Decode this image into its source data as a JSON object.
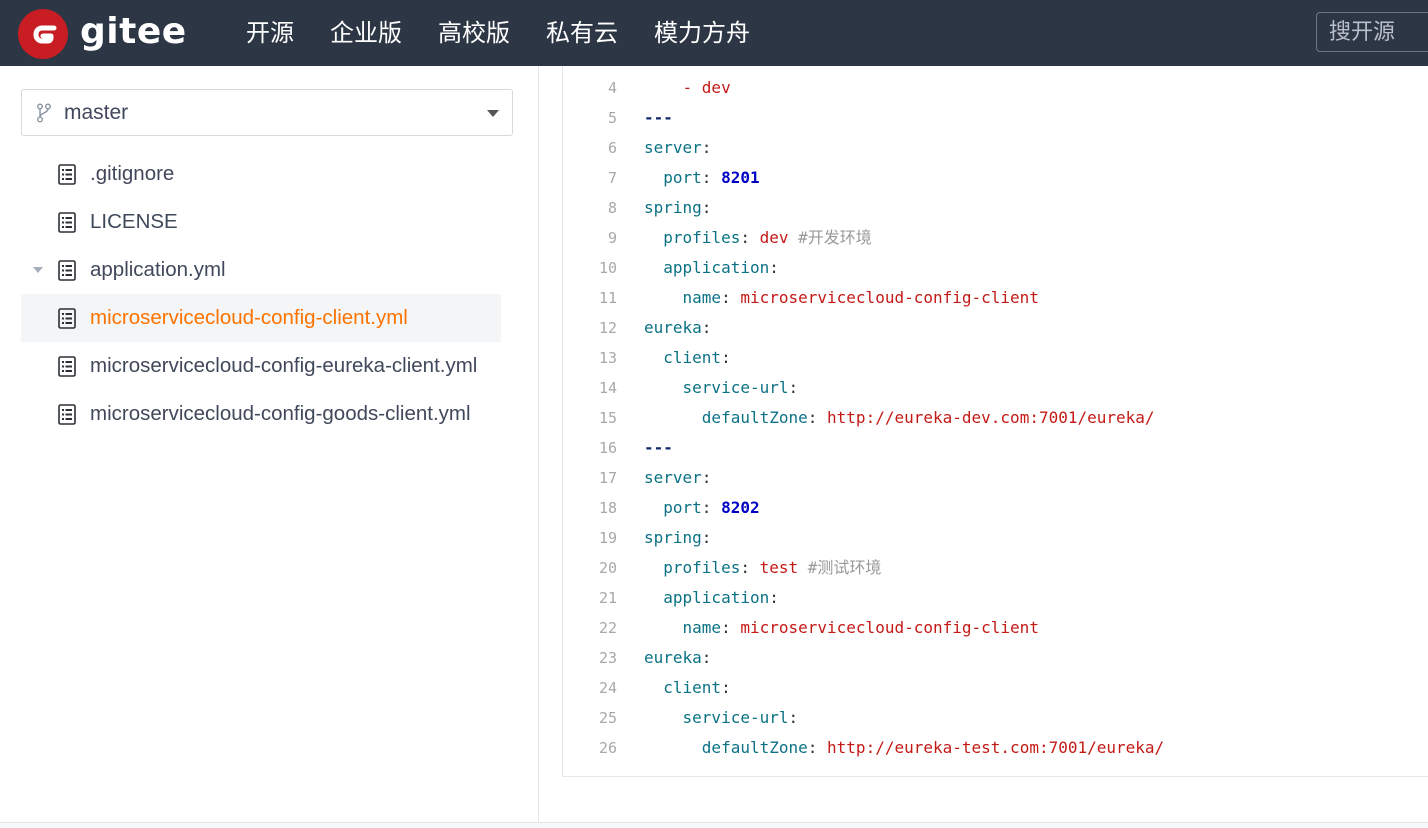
{
  "header": {
    "brand": "gitee",
    "nav": [
      "开源",
      "企业版",
      "高校版",
      "私有云",
      "模力方舟"
    ],
    "search_placeholder": "搜开源",
    "colors": {
      "bar": "#2d3645",
      "logo": "#c71d23"
    }
  },
  "sidebar": {
    "branch": "master",
    "files": [
      {
        "name": ".gitignore",
        "active": false,
        "expandable": false
      },
      {
        "name": "LICENSE",
        "active": false,
        "expandable": false
      },
      {
        "name": "application.yml",
        "active": false,
        "expandable": true
      },
      {
        "name": "microservicecloud-config-client.yml",
        "active": true,
        "expandable": false
      },
      {
        "name": "microservicecloud-config-eureka-client.yml",
        "active": false,
        "expandable": false
      },
      {
        "name": "microservicecloud-config-goods-client.yml",
        "active": false,
        "expandable": false
      }
    ],
    "active_color": "#fe7300"
  },
  "code": {
    "lines": [
      {
        "n": "4",
        "tokens": [
          [
            "plain",
            "    "
          ],
          [
            "val",
            "- dev"
          ]
        ]
      },
      {
        "n": "5",
        "tokens": [
          [
            "sep",
            "---"
          ]
        ]
      },
      {
        "n": "6",
        "tokens": [
          [
            "key",
            "server"
          ],
          [
            "plain",
            ":"
          ]
        ]
      },
      {
        "n": "7",
        "tokens": [
          [
            "plain",
            "  "
          ],
          [
            "key",
            "port"
          ],
          [
            "plain",
            ": "
          ],
          [
            "num",
            "8201"
          ]
        ]
      },
      {
        "n": "8",
        "tokens": [
          [
            "key",
            "spring"
          ],
          [
            "plain",
            ":"
          ]
        ]
      },
      {
        "n": "9",
        "tokens": [
          [
            "plain",
            "  "
          ],
          [
            "key",
            "profiles"
          ],
          [
            "plain",
            ": "
          ],
          [
            "val",
            "dev"
          ],
          [
            "plain",
            " "
          ],
          [
            "com",
            "#开发环境"
          ]
        ]
      },
      {
        "n": "10",
        "tokens": [
          [
            "plain",
            "  "
          ],
          [
            "key",
            "application"
          ],
          [
            "plain",
            ":"
          ]
        ]
      },
      {
        "n": "11",
        "tokens": [
          [
            "plain",
            "    "
          ],
          [
            "key",
            "name"
          ],
          [
            "plain",
            ": "
          ],
          [
            "val",
            "microservicecloud-config-client"
          ]
        ]
      },
      {
        "n": "12",
        "tokens": [
          [
            "key",
            "eureka"
          ],
          [
            "plain",
            ":"
          ]
        ]
      },
      {
        "n": "13",
        "tokens": [
          [
            "plain",
            "  "
          ],
          [
            "key",
            "client"
          ],
          [
            "plain",
            ":"
          ]
        ]
      },
      {
        "n": "14",
        "tokens": [
          [
            "plain",
            "    "
          ],
          [
            "key",
            "service-url"
          ],
          [
            "plain",
            ":"
          ]
        ]
      },
      {
        "n": "15",
        "tokens": [
          [
            "plain",
            "      "
          ],
          [
            "key",
            "defaultZone"
          ],
          [
            "plain",
            ": "
          ],
          [
            "val",
            "http://eureka-dev.com:7001/eureka/"
          ]
        ]
      },
      {
        "n": "16",
        "tokens": [
          [
            "sep",
            "---"
          ]
        ]
      },
      {
        "n": "17",
        "tokens": [
          [
            "key",
            "server"
          ],
          [
            "plain",
            ":"
          ]
        ]
      },
      {
        "n": "18",
        "tokens": [
          [
            "plain",
            "  "
          ],
          [
            "key",
            "port"
          ],
          [
            "plain",
            ": "
          ],
          [
            "num",
            "8202"
          ]
        ]
      },
      {
        "n": "19",
        "tokens": [
          [
            "key",
            "spring"
          ],
          [
            "plain",
            ":"
          ]
        ]
      },
      {
        "n": "20",
        "tokens": [
          [
            "plain",
            "  "
          ],
          [
            "key",
            "profiles"
          ],
          [
            "plain",
            ": "
          ],
          [
            "val",
            "test"
          ],
          [
            "plain",
            " "
          ],
          [
            "com",
            "#测试环境"
          ]
        ]
      },
      {
        "n": "21",
        "tokens": [
          [
            "plain",
            "  "
          ],
          [
            "key",
            "application"
          ],
          [
            "plain",
            ":"
          ]
        ]
      },
      {
        "n": "22",
        "tokens": [
          [
            "plain",
            "    "
          ],
          [
            "key",
            "name"
          ],
          [
            "plain",
            ": "
          ],
          [
            "val",
            "microservicecloud-config-client"
          ]
        ]
      },
      {
        "n": "23",
        "tokens": [
          [
            "key",
            "eureka"
          ],
          [
            "plain",
            ":"
          ]
        ]
      },
      {
        "n": "24",
        "tokens": [
          [
            "plain",
            "  "
          ],
          [
            "key",
            "client"
          ],
          [
            "plain",
            ":"
          ]
        ]
      },
      {
        "n": "25",
        "tokens": [
          [
            "plain",
            "    "
          ],
          [
            "key",
            "service-url"
          ],
          [
            "plain",
            ":"
          ]
        ]
      },
      {
        "n": "26",
        "tokens": [
          [
            "plain",
            "      "
          ],
          [
            "key",
            "defaultZone"
          ],
          [
            "plain",
            ": "
          ],
          [
            "val",
            "http://eureka-test.com:7001/eureka/"
          ]
        ]
      }
    ],
    "colors": {
      "key": "#0b7285",
      "value": "#c41a16",
      "number": "#0000c5",
      "comment": "#999999"
    }
  }
}
